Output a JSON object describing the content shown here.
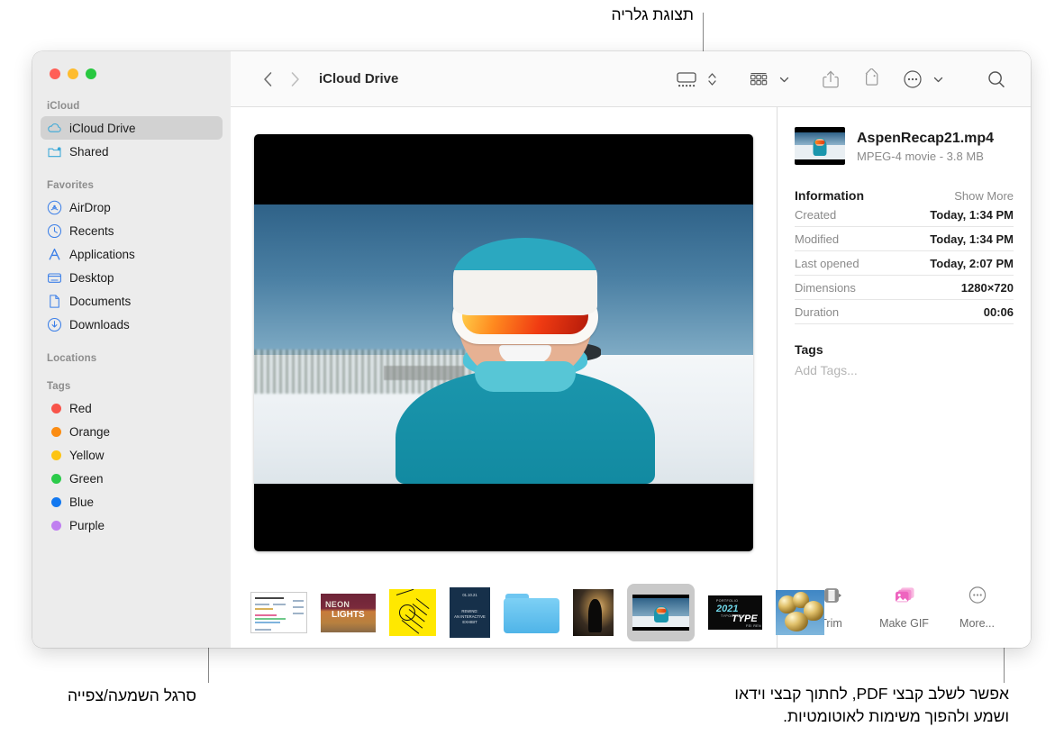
{
  "annotations": {
    "top": "תצוגת גלריה",
    "bottom_left": "סרגל השמעה/צפייה",
    "bottom_right": "אפשר לשלב קבצי PDF, לחתוך קבצי וידאו\nושמע ולהפוך משימות לאוטומטיות."
  },
  "window": {
    "traffic_lights": {
      "close": "close",
      "minimize": "minimize",
      "zoom": "zoom"
    }
  },
  "toolbar": {
    "back": "back",
    "forward": "forward",
    "title": "iCloud Drive",
    "view_gallery": "gallery-view",
    "view_stepper": "view-stepper",
    "group_by": "group-by",
    "share": "share",
    "tag": "tag",
    "more": "more-actions",
    "search": "search"
  },
  "sidebar": {
    "sections": [
      {
        "header": "iCloud",
        "items": [
          {
            "label": "iCloud Drive",
            "icon": "cloud-icon",
            "active": true
          },
          {
            "label": "Shared",
            "icon": "shared-folder-icon",
            "active": false
          }
        ]
      },
      {
        "header": "Favorites",
        "items": [
          {
            "label": "AirDrop",
            "icon": "airdrop-icon",
            "active": false
          },
          {
            "label": "Recents",
            "icon": "clock-icon",
            "active": false
          },
          {
            "label": "Applications",
            "icon": "applications-icon",
            "active": false
          },
          {
            "label": "Desktop",
            "icon": "desktop-icon",
            "active": false
          },
          {
            "label": "Documents",
            "icon": "document-icon",
            "active": false
          },
          {
            "label": "Downloads",
            "icon": "downloads-icon",
            "active": false
          }
        ]
      },
      {
        "header": "Locations",
        "items": []
      },
      {
        "header": "Tags",
        "items": [
          {
            "label": "Red",
            "color": "#f8544a"
          },
          {
            "label": "Orange",
            "color": "#fb8c12"
          },
          {
            "label": "Yellow",
            "color": "#fdc413"
          },
          {
            "label": "Green",
            "color": "#2bcb4a"
          },
          {
            "label": "Blue",
            "color": "#1278f0"
          },
          {
            "label": "Purple",
            "color": "#c07ff0"
          }
        ]
      }
    ]
  },
  "preview": {
    "alt": "AspenRecap21 video frame - skier in teal jacket with orange goggles"
  },
  "filmstrip": {
    "items": [
      {
        "name": "poster-document-thumbnail",
        "selected": false
      },
      {
        "name": "neon-lights-thumbnail",
        "selected": false,
        "text_a": "NEON",
        "text_b": "LIGHTS"
      },
      {
        "name": "thank-you-smiley-thumbnail",
        "selected": false
      },
      {
        "name": "navy-exhibit-thumbnail",
        "selected": false,
        "line1": "01.10.21",
        "line2": "REWIND:",
        "line3": "AN INTERACTIVE",
        "line4": "EXHIBIT"
      },
      {
        "name": "blue-folder-thumbnail",
        "selected": false
      },
      {
        "name": "dark-portrait-thumbnail",
        "selected": false
      },
      {
        "name": "aspen-recap-video-thumbnail",
        "selected": true
      },
      {
        "name": "typography-2021-thumbnail",
        "selected": false,
        "year": "2021",
        "word": "TYPE",
        "top": "PORTFOLIO",
        "mid": "TYPOGRAPHY",
        "author": "FEI REN"
      },
      {
        "name": "gold-balloons-thumbnail",
        "selected": false
      }
    ]
  },
  "info_panel": {
    "file": {
      "name": "AspenRecap21.mp4",
      "meta": "MPEG-4 movie - 3.8 MB"
    },
    "information": {
      "title": "Information",
      "show_more": "Show More",
      "rows": [
        {
          "key": "Created",
          "value": "Today, 1:34 PM"
        },
        {
          "key": "Modified",
          "value": "Today, 1:34 PM"
        },
        {
          "key": "Last opened",
          "value": "Today, 2:07 PM"
        },
        {
          "key": "Dimensions",
          "value": "1280×720"
        },
        {
          "key": "Duration",
          "value": "00:06"
        }
      ]
    },
    "tags": {
      "title": "Tags",
      "placeholder": "Add Tags..."
    },
    "actions": [
      {
        "label": "Trim",
        "icon": "trim-icon"
      },
      {
        "label": "Make GIF",
        "icon": "make-gif-icon"
      },
      {
        "label": "More...",
        "icon": "more-circle-icon"
      }
    ]
  },
  "colors": {
    "accent_blue": "#1278f0",
    "gif_pink": "#f472c8",
    "sidebar_bg": "#ececec",
    "selected_row": "#d2d2d2"
  }
}
